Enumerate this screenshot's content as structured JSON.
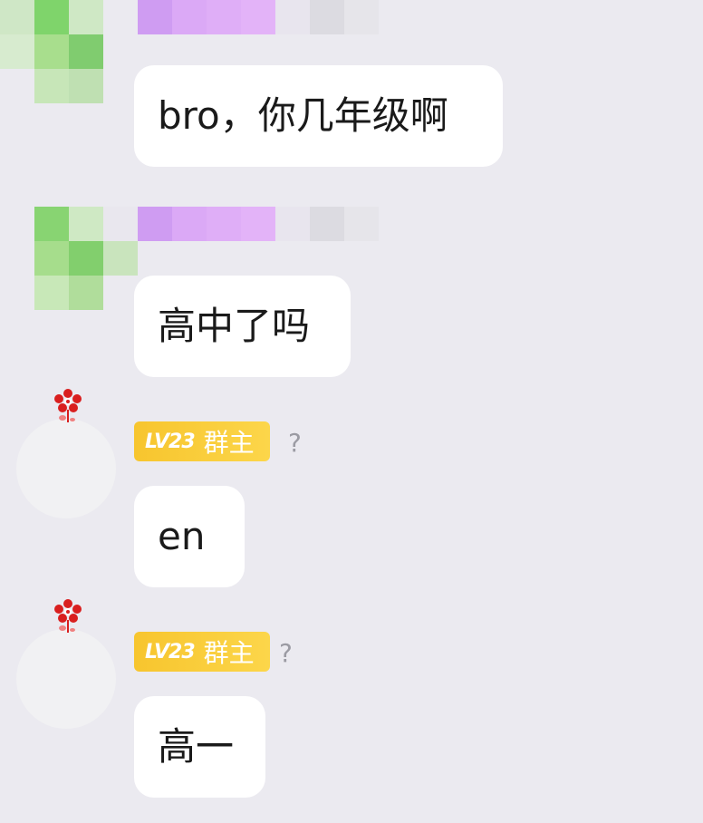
{
  "colors": {
    "background": "#ebeaf0",
    "bubble": "#ffffff",
    "badge": "#f9cb3a",
    "mosaic_green": [
      "#7fd46b",
      "#a8de8d",
      "#c5e7b6",
      "#d6ead0"
    ],
    "mosaic_purple": [
      "#cf9cf2",
      "#dba9f6",
      "#e3b3f8",
      "#e8e5ee",
      "#dcdbe1"
    ]
  },
  "messages": [
    {
      "sender": "redacted",
      "avatar_icon": "pixelated-avatar",
      "text": "bro，你几年级啊"
    },
    {
      "sender": "redacted",
      "avatar_icon": "pixelated-avatar",
      "text": "高中了吗"
    },
    {
      "sender": "group-owner",
      "avatar_icon": "flower-icon",
      "badge": {
        "level": "LV23",
        "role": "群主"
      },
      "name": "?",
      "text": "en"
    },
    {
      "sender": "group-owner",
      "avatar_icon": "flower-icon",
      "badge": {
        "level": "LV23",
        "role": "群主"
      },
      "name": "?",
      "text": "高一"
    }
  ]
}
